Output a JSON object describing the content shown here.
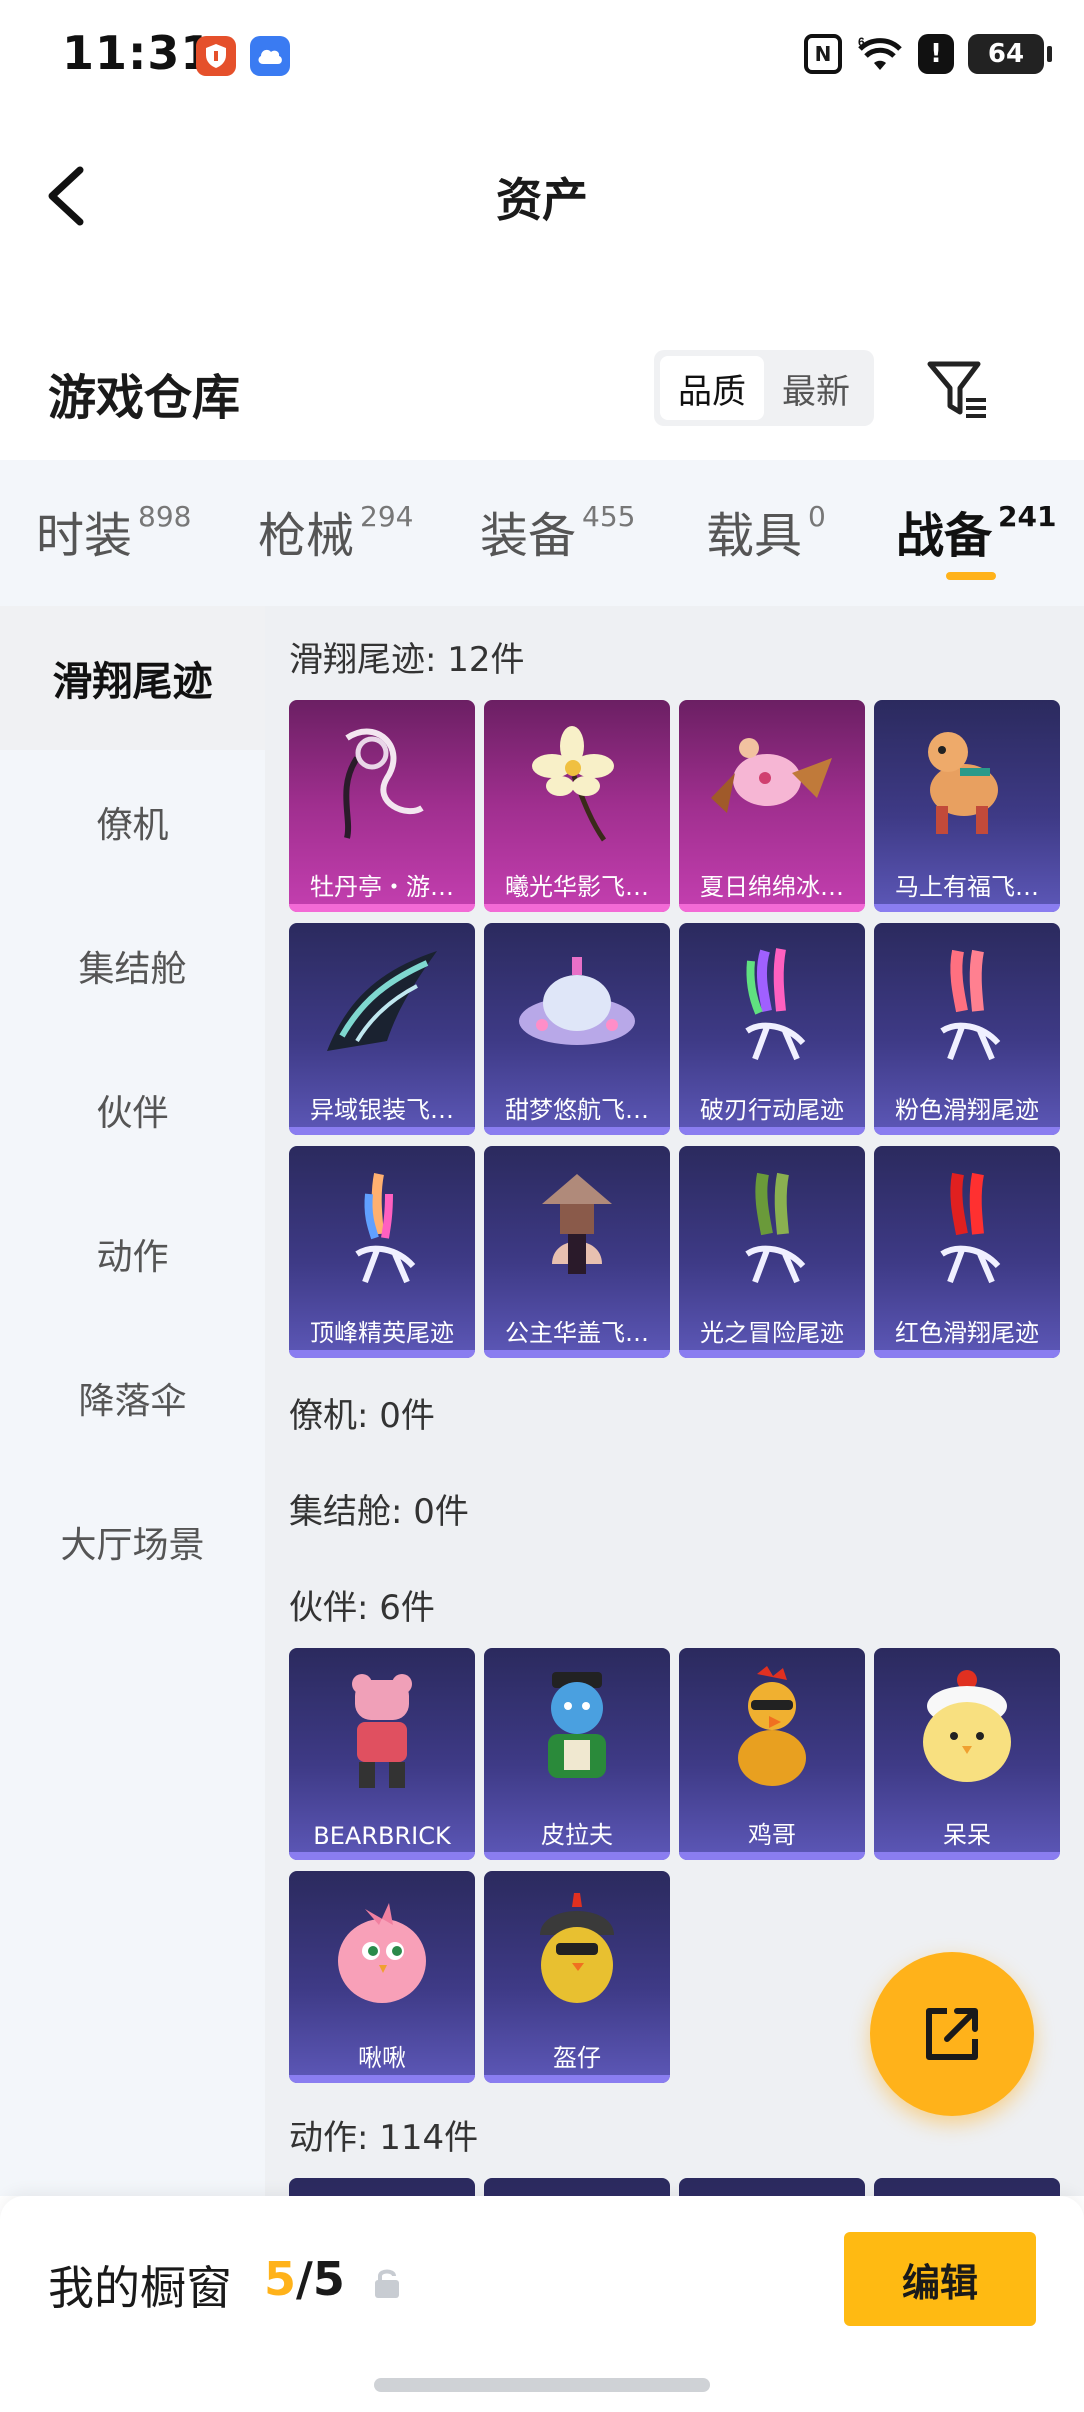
{
  "status_bar": {
    "time": "11:31",
    "app_icons": [
      "shield-icon",
      "cloud-icon"
    ],
    "indicators": [
      "nfc-icon",
      "wifi-6-icon",
      "alert-icon"
    ],
    "battery": "64"
  },
  "header": {
    "title": "资产"
  },
  "warehouse": {
    "title": "游戏仓库",
    "sort_options": [
      "品质",
      "最新"
    ],
    "active_sort": "品质"
  },
  "tabs": [
    {
      "label": "时装",
      "count": "898"
    },
    {
      "label": "枪械",
      "count": "294"
    },
    {
      "label": "装备",
      "count": "455"
    },
    {
      "label": "载具",
      "count": "0"
    },
    {
      "label": "战备",
      "count": "241"
    }
  ],
  "active_tab": "战备",
  "sidebar": {
    "items": [
      "滑翔尾迹",
      "僚机",
      "集结舱",
      "伙伴",
      "动作",
      "降落伞",
      "大厅场景"
    ],
    "active": "滑翔尾迹"
  },
  "sections": {
    "glide_trail": {
      "title": "滑翔尾迹: 12件",
      "items": [
        {
          "label": "牡丹亭・游…",
          "rarity": "pink"
        },
        {
          "label": "曦光华影飞…",
          "rarity": "pink"
        },
        {
          "label": "夏日绵绵冰…",
          "rarity": "pink"
        },
        {
          "label": "马上有福飞…",
          "rarity": "purple"
        },
        {
          "label": "异域银装飞…",
          "rarity": "purple"
        },
        {
          "label": "甜梦悠航飞…",
          "rarity": "purple"
        },
        {
          "label": "破刃行动尾迹",
          "rarity": "purple"
        },
        {
          "label": "粉色滑翔尾迹",
          "rarity": "purple"
        },
        {
          "label": "顶峰精英尾迹",
          "rarity": "purple"
        },
        {
          "label": "公主华盖飞…",
          "rarity": "purple"
        },
        {
          "label": "光之冒险尾迹",
          "rarity": "purple"
        },
        {
          "label": "红色滑翔尾迹",
          "rarity": "purple"
        }
      ]
    },
    "wingman": {
      "title": "僚机: 0件"
    },
    "rally_pod": {
      "title": "集结舱: 0件"
    },
    "companion": {
      "title": "伙伴: 6件",
      "items": [
        {
          "label": "BEARBRICK"
        },
        {
          "label": "皮拉夫"
        },
        {
          "label": "鸡哥"
        },
        {
          "label": "呆呆"
        },
        {
          "label": "啾啾"
        },
        {
          "label": "盔仔"
        }
      ]
    },
    "emote": {
      "title": "动作: 114件"
    }
  },
  "showcase": {
    "label": "我的橱窗",
    "current": "5",
    "total": "/5",
    "edit_label": "编辑"
  },
  "colors": {
    "accent": "#ffb21a",
    "card_pink": "#a02f8f",
    "card_purple": "#3e3a86"
  }
}
